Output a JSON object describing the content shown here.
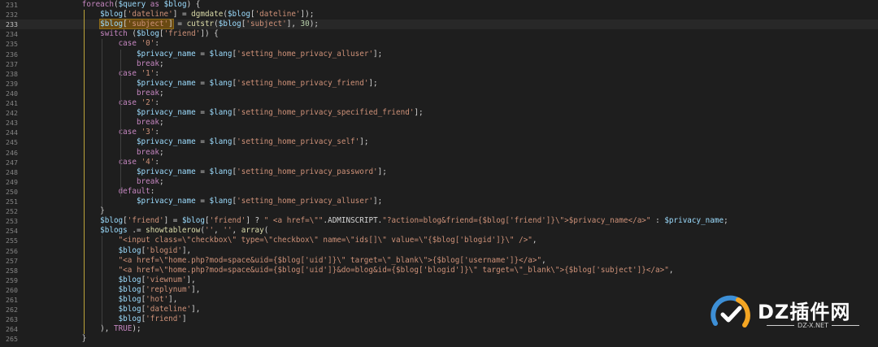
{
  "editor": {
    "current_line": 233,
    "lines": [
      {
        "n": "231",
        "t": "        foreach($query as $blog) {"
      },
      {
        "n": "232",
        "t": "            $blog['dateline'] = dgmdate($blog['dateline']);"
      },
      {
        "n": "233",
        "t": "            $blog['subject'] = cutstr($blog['subject'], 30);"
      },
      {
        "n": "234",
        "t": "            switch ($blog['friend']) {"
      },
      {
        "n": "235",
        "t": "                case '0':"
      },
      {
        "n": "236",
        "t": "                    $privacy_name = $lang['setting_home_privacy_alluser'];"
      },
      {
        "n": "237",
        "t": "                    break;"
      },
      {
        "n": "238",
        "t": "                case '1':"
      },
      {
        "n": "239",
        "t": "                    $privacy_name = $lang['setting_home_privacy_friend'];"
      },
      {
        "n": "240",
        "t": "                    break;"
      },
      {
        "n": "241",
        "t": "                case '2':"
      },
      {
        "n": "242",
        "t": "                    $privacy_name = $lang['setting_home_privacy_specified_friend'];"
      },
      {
        "n": "243",
        "t": "                    break;"
      },
      {
        "n": "244",
        "t": "                case '3':"
      },
      {
        "n": "245",
        "t": "                    $privacy_name = $lang['setting_home_privacy_self'];"
      },
      {
        "n": "246",
        "t": "                    break;"
      },
      {
        "n": "247",
        "t": "                case '4':"
      },
      {
        "n": "248",
        "t": "                    $privacy_name = $lang['setting_home_privacy_password'];"
      },
      {
        "n": "249",
        "t": "                    break;"
      },
      {
        "n": "250",
        "t": "                default:"
      },
      {
        "n": "251",
        "t": "                    $privacy_name = $lang['setting_home_privacy_alluser'];"
      },
      {
        "n": "252",
        "t": "            }"
      },
      {
        "n": "253",
        "t": "            $blog['friend'] = $blog['friend'] ? \" <a href=\\\"\".ADMINSCRIPT.\"?action=blog&friend={$blog['friend']}\\\">$privacy_name</a>\" : $privacy_name;"
      },
      {
        "n": "254",
        "t": "            $blogs .= showtablerow('', '', array("
      },
      {
        "n": "255",
        "t": "                \"<input class=\\\"checkbox\\\" type=\\\"checkbox\\\" name=\\\"ids[]\\\" value=\\\"{$blog['blogid']}\\\" />\","
      },
      {
        "n": "256",
        "t": "                $blog['blogid'],"
      },
      {
        "n": "257",
        "t": "                \"<a href=\\\"home.php?mod=space&uid={$blog['uid']}\\\" target=\\\"_blank\\\">{$blog['username']}</a>\","
      },
      {
        "n": "258",
        "t": "                \"<a href=\\\"home.php?mod=space&uid={$blog['uid']}&do=blog&id={$blog['blogid']}\\\" target=\\\"_blank\\\">{$blog['subject']}</a>\","
      },
      {
        "n": "259",
        "t": "                $blog['viewnum'],"
      },
      {
        "n": "260",
        "t": "                $blog['replynum'],"
      },
      {
        "n": "261",
        "t": "                $blog['hot'],"
      },
      {
        "n": "262",
        "t": "                $blog['dateline'],"
      },
      {
        "n": "263",
        "t": "                $blog['friend']"
      },
      {
        "n": "264",
        "t": "            ), TRUE);"
      },
      {
        "n": "265",
        "t": "        }"
      }
    ]
  },
  "watermark": {
    "title": "DZ插件网",
    "subtitle": "DZ-X.NET",
    "colors": {
      "arc_blue": "#3d8fd6",
      "arc_orange": "#f5a623",
      "check_white": "#ffffff"
    }
  }
}
